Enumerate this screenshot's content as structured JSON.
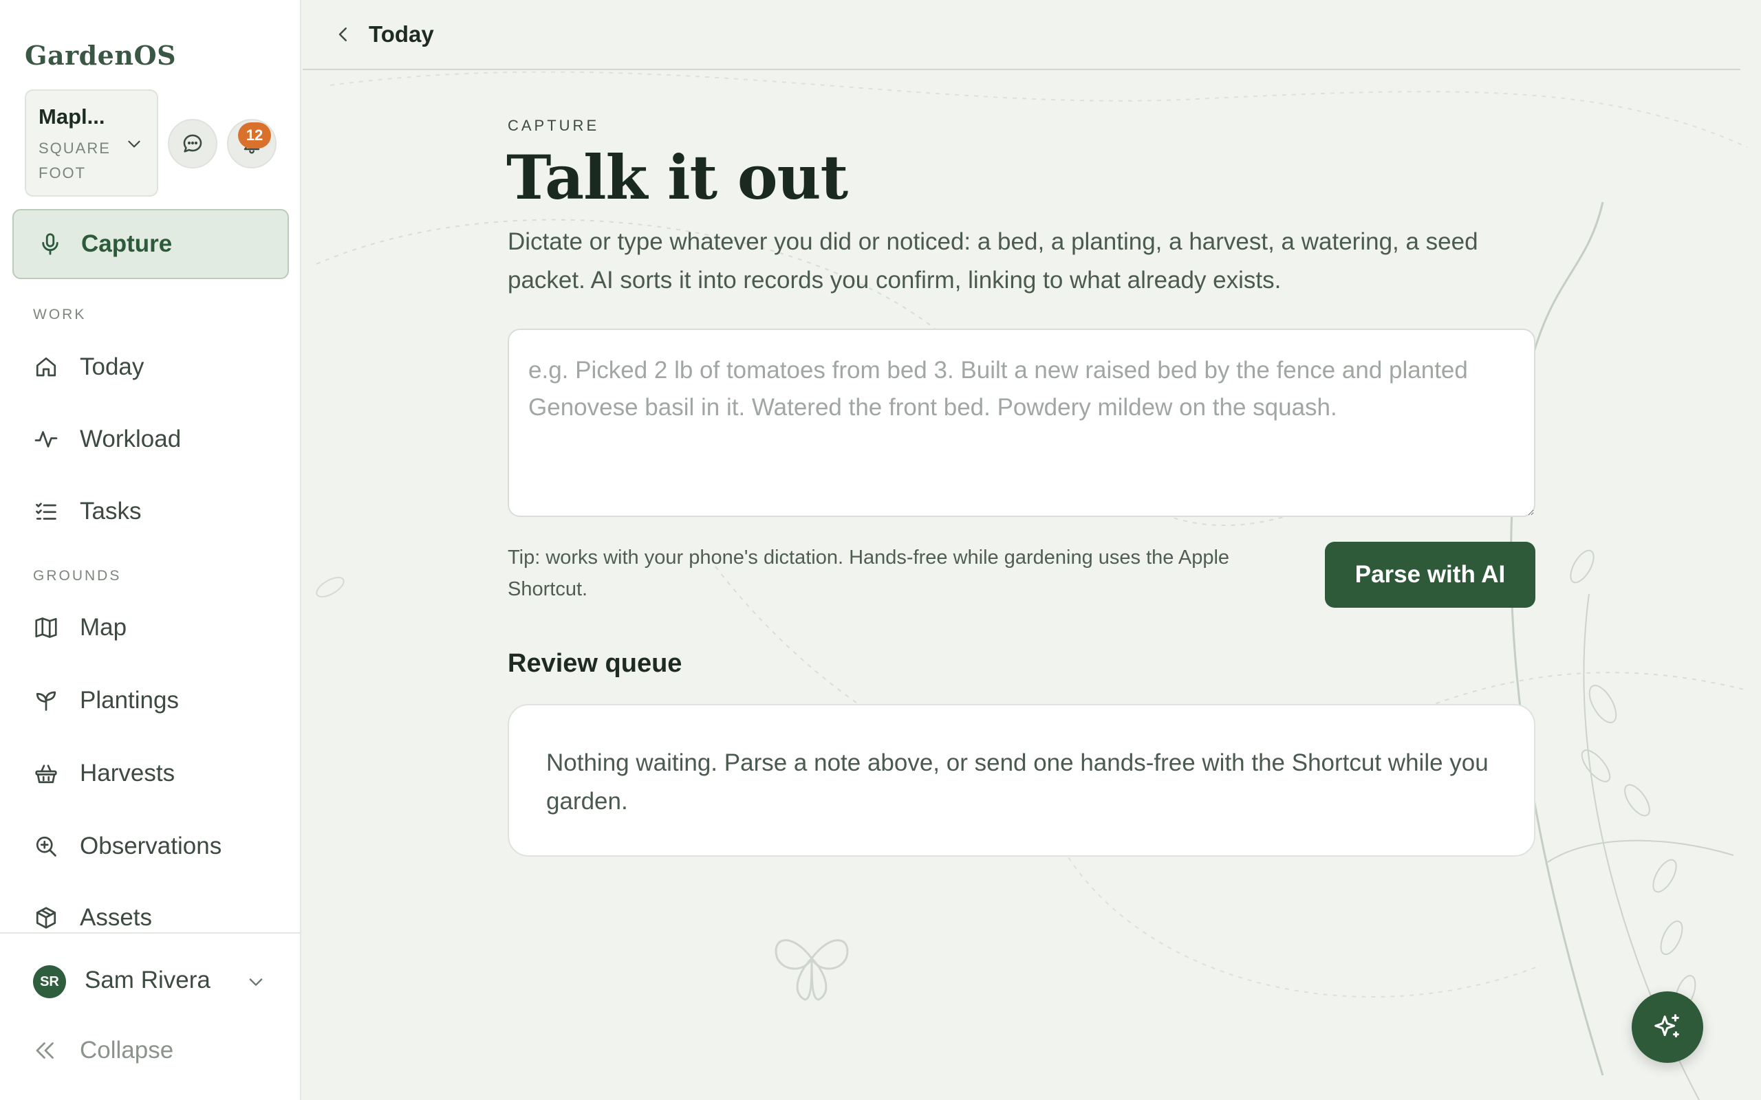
{
  "app": {
    "name": "GardenOS"
  },
  "site": {
    "name": "Mapl...",
    "type": "SQUARE FOOT",
    "chevron_icon": "chevron-down-icon"
  },
  "header_actions": {
    "chat_icon": "chat-bubble-icon",
    "notifications_icon": "bell-icon",
    "notifications_count": "12"
  },
  "sidebar": {
    "primary": {
      "label": "Capture",
      "icon": "microphone-icon"
    },
    "sections": [
      {
        "label": "WORK",
        "items": [
          {
            "label": "Today",
            "icon": "home-icon"
          },
          {
            "label": "Workload",
            "icon": "activity-icon"
          },
          {
            "label": "Tasks",
            "icon": "checklist-icon"
          }
        ]
      },
      {
        "label": "GROUNDS",
        "items": [
          {
            "label": "Map",
            "icon": "map-icon"
          },
          {
            "label": "Plantings",
            "icon": "sprout-icon"
          },
          {
            "label": "Harvests",
            "icon": "basket-icon"
          },
          {
            "label": "Observations",
            "icon": "search-plus-icon"
          },
          {
            "label": "Assets",
            "icon": "box-icon"
          }
        ]
      }
    ],
    "user": {
      "initials": "SR",
      "name": "Sam Rivera"
    },
    "collapse_label": "Collapse"
  },
  "topbar": {
    "back_label": "Today"
  },
  "main": {
    "eyebrow": "CAPTURE",
    "title": "Talk it out",
    "intro": "Dictate or type whatever you did or noticed: a bed, a planting, a harvest, a watering, a seed packet. AI sorts it into records you confirm, linking to what already exists.",
    "note_input": {
      "value": "",
      "placeholder": "e.g. Picked 2 lb of tomatoes from bed 3. Built a new raised bed by the fence and planted Genovese basil in it. Watered the front bed. Powdery mildew on the squash."
    },
    "tip": "Tip: works with your phone's dictation. Hands-free while gardening uses the Apple Shortcut.",
    "parse_button": "Parse with AI",
    "review_heading": "Review queue",
    "review_empty": "Nothing waiting. Parse a note above, or send one hands-free with the Shortcut while you garden."
  },
  "fab": {
    "icon": "sparkles-icon"
  },
  "colors": {
    "accent": "#2e5a39",
    "accent_light": "#e2ebe2",
    "badge": "#d9712d",
    "background": "#f1f3ef"
  }
}
